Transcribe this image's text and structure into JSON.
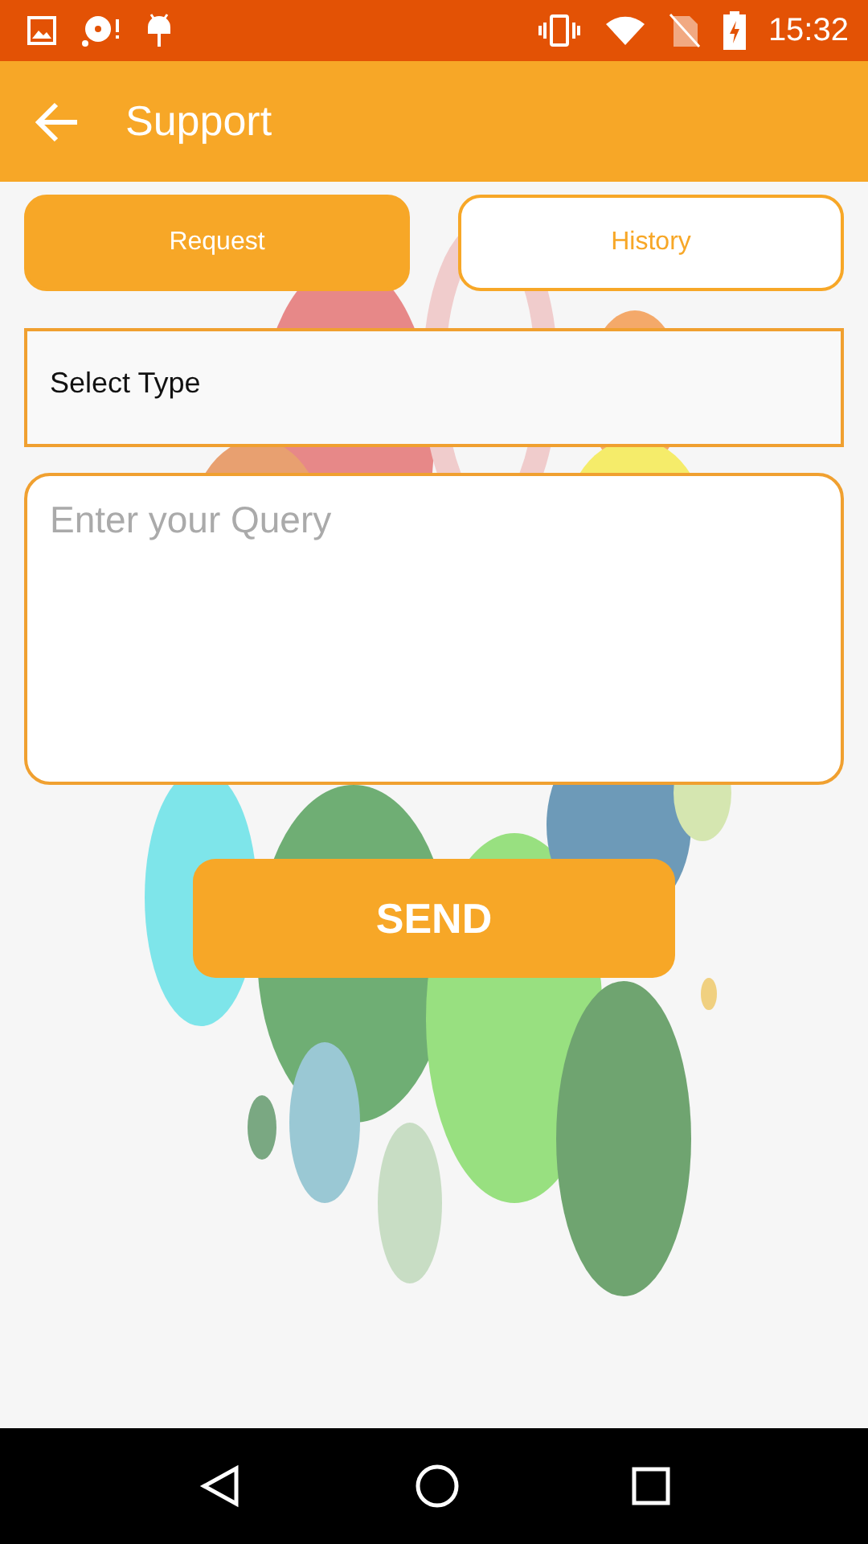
{
  "status_bar": {
    "time": "15:32"
  },
  "app_bar": {
    "title": "Support"
  },
  "tabs": [
    {
      "label": "Request",
      "selected": true
    },
    {
      "label": "History",
      "selected": false
    }
  ],
  "type_select": {
    "value": "Select Type"
  },
  "query": {
    "placeholder": "Enter your Query"
  },
  "send_button": {
    "label": "SEND"
  }
}
